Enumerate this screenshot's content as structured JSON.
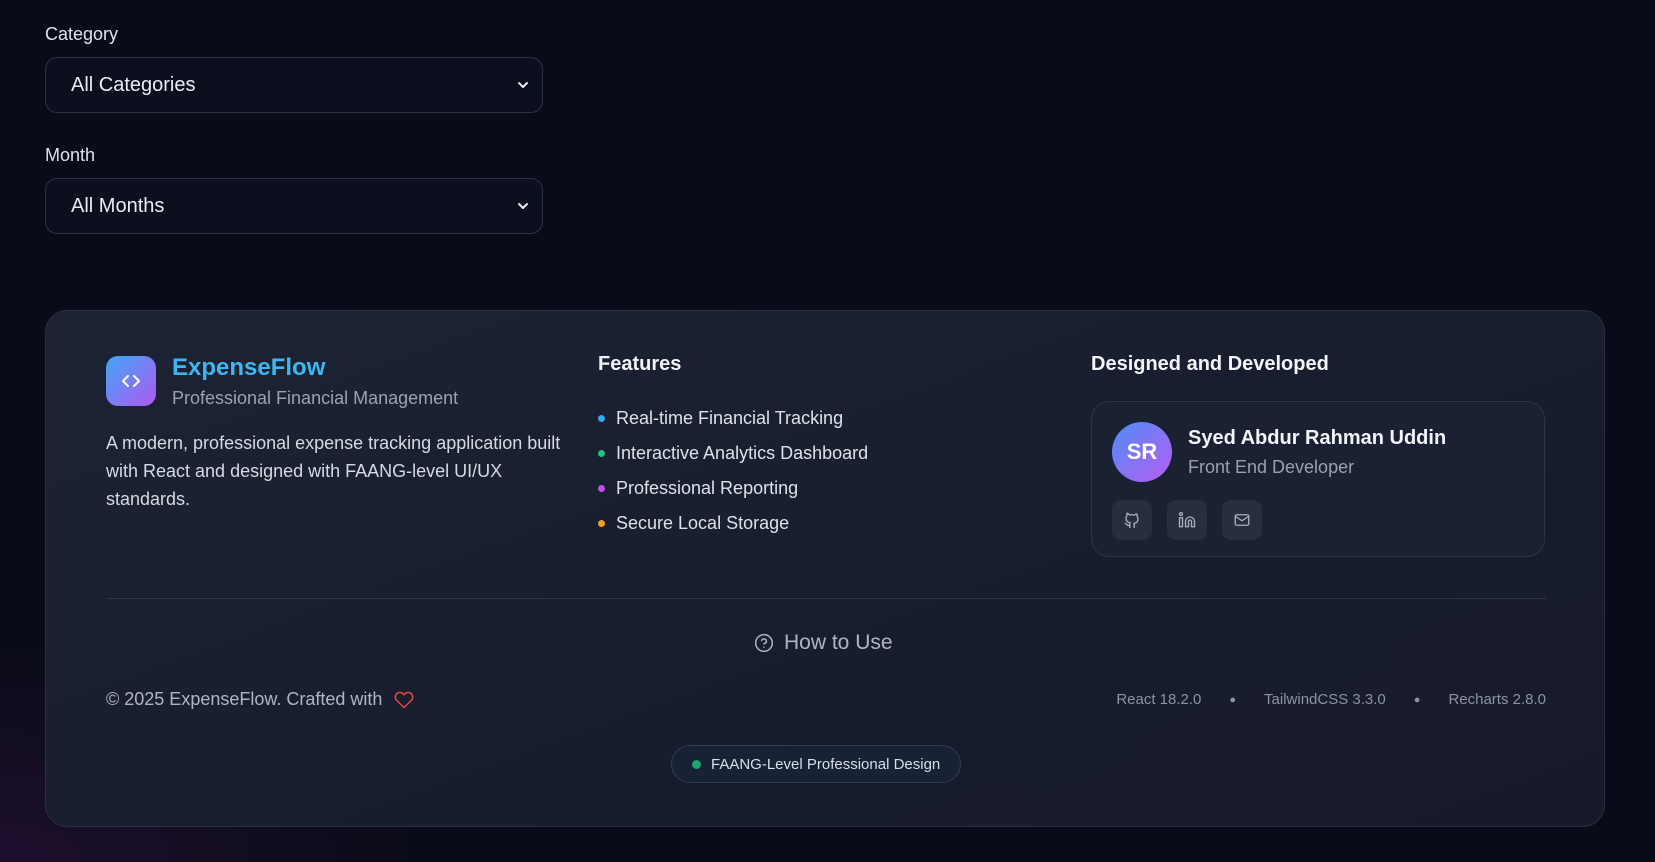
{
  "filters": {
    "category_label": "Category",
    "category_value": "All Categories",
    "month_label": "Month",
    "month_value": "All Months"
  },
  "brand": {
    "name": "ExpenseFlow",
    "tagline": "Professional Financial Management",
    "description": "A modern, professional expense tracking application built with React and designed with FAANG-level UI/UX standards."
  },
  "features": {
    "title": "Features",
    "items": [
      {
        "label": "Real-time Financial Tracking",
        "color": "#37a7ee"
      },
      {
        "label": "Interactive Analytics Dashboard",
        "color": "#22c27a"
      },
      {
        "label": "Professional Reporting",
        "color": "#c04ee8"
      },
      {
        "label": "Secure Local Storage",
        "color": "#f0a21f"
      }
    ]
  },
  "developer": {
    "section_title": "Designed and Developed",
    "initials": "SR",
    "name": "Syed Abdur Rahman Uddin",
    "role": "Front End Developer",
    "socials": [
      "github-icon",
      "linkedin-icon",
      "mail-icon"
    ]
  },
  "how_to_use": "How to Use",
  "copyright": "© 2025 ExpenseFlow.  Crafted with",
  "tech": [
    "React 18.2.0",
    "TailwindCSS 3.3.0",
    "Recharts 2.8.0"
  ],
  "badge": "FAANG-Level Professional Design",
  "colors": {
    "background": "#0a0b18",
    "accent": "#3fb6f2",
    "heart": "#e0474c"
  }
}
